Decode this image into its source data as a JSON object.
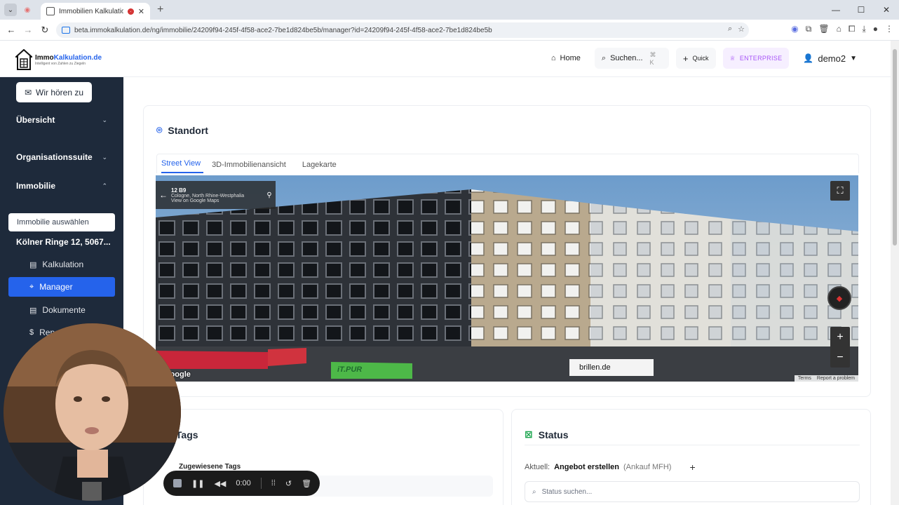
{
  "browser": {
    "tab_title": "Immobilien Kalkulationstoo",
    "url": "beta.immokalkulation.de/ng/immobilie/24209f94-245f-4f58-ace2-7be1d824be5b/manager?id=24209f94-245f-4f58-ace2-7be1d824be5b",
    "new_tab": "+",
    "win_min": "—",
    "win_max": "☐",
    "win_close": "✕"
  },
  "header": {
    "logo_brand_a": "Immo",
    "logo_brand_b": "Kalkulation.de",
    "logo_tagline": "Intelligent von Zahlen zu Ziegeln",
    "home": "Home",
    "search": "Suchen...",
    "search_kbd": "⌘ K",
    "quick": "Quick",
    "enterprise": "ENTERPRISE",
    "user": "demo2"
  },
  "sidebar": {
    "feedback": "Wir hören zu",
    "overview": "Übersicht",
    "orgsuite": "Organisationssuite",
    "property": "Immobilie",
    "select_property": "Immobilie auswählen",
    "address": "Kölner Ringe 12, 5067...",
    "items": [
      {
        "label": "Kalkulation",
        "icon": "📄"
      },
      {
        "label": "Manager",
        "icon": "🏷"
      },
      {
        "label": "Dokumente",
        "icon": "📄"
      },
      {
        "label": "Repo",
        "icon": "$"
      }
    ]
  },
  "location": {
    "title": "Standort",
    "tabs": [
      "Street View",
      "3D-Immobilienansicht",
      "Lagekarte"
    ],
    "sv_line1": "12 B9",
    "sv_line2": "Cologne, North Rhine-Westphalia",
    "sv_line3": "View on Google Maps",
    "sv_google": "Google",
    "sv_terms": "Terms",
    "sv_report": "Report a problem",
    "sign_brillen": "brillen.de",
    "sign_itpur": "iT.PUR"
  },
  "tags": {
    "title": "Tags",
    "assigned": "Zugewiesene Tags"
  },
  "status": {
    "title": "Status",
    "current_label": "Aktuell:",
    "current_value": "Angebot erstellen",
    "current_sub": "(Ankauf MFH)",
    "search_placeholder": "Status suchen..."
  },
  "recorder": {
    "time": "0:00"
  },
  "colors": {
    "sidebar_bg": "#1e2a3b",
    "accent": "#2563eb",
    "enterprise": "#a855f7"
  }
}
